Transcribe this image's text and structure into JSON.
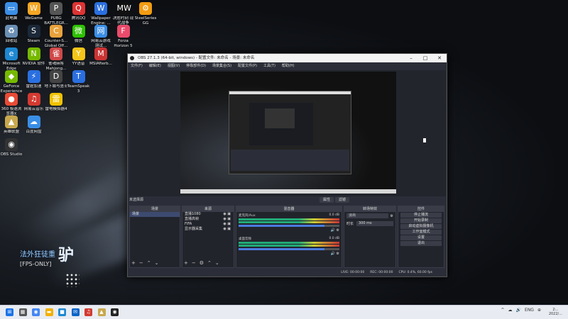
{
  "desktop": {
    "icons": [
      {
        "label": "此电脑",
        "glyph": "▭",
        "color": "#3a8ee6",
        "col": 0,
        "row": 0
      },
      {
        "label": "回收站",
        "glyph": "♻",
        "color": "#6b8fb5",
        "col": 0,
        "row": 1
      },
      {
        "label": "Microsoft Edge",
        "glyph": "e",
        "color": "#1e88d2",
        "col": 0,
        "row": 2
      },
      {
        "label": "GeForce Experience",
        "glyph": "◆",
        "color": "#76b900",
        "col": 0,
        "row": 3
      },
      {
        "label": "360 极速浏览器X",
        "glyph": "●",
        "color": "#e94b35",
        "col": 0,
        "row": 4
      },
      {
        "label": "英雄联盟",
        "glyph": "▲",
        "color": "#c8a84e",
        "col": 0,
        "row": 5
      },
      {
        "label": "OBS Studio",
        "glyph": "◉",
        "color": "#333",
        "col": 0,
        "row": 6
      },
      {
        "label": "WeGame",
        "glyph": "W",
        "color": "#f5a623",
        "col": 1,
        "row": 0
      },
      {
        "label": "Steam",
        "glyph": "S",
        "color": "#1b2838",
        "col": 1,
        "row": 1
      },
      {
        "label": "NVIDIA 软件",
        "glyph": "N",
        "color": "#76b900",
        "col": 1,
        "row": 2
      },
      {
        "label": "雷霆加速",
        "glyph": "⚡",
        "color": "#2a6fe0",
        "col": 1,
        "row": 3
      },
      {
        "label": "网易云音乐",
        "glyph": "♫",
        "color": "#d33a31",
        "col": 1,
        "row": 4
      },
      {
        "label": "百度网盘",
        "glyph": "☁",
        "color": "#3a8ee6",
        "col": 1,
        "row": 5
      },
      {
        "label": "PUBG BATTLEGR...",
        "glyph": "P",
        "color": "#555",
        "col": 2,
        "row": 0
      },
      {
        "label": "Counter-S... Global Off...",
        "glyph": "C",
        "color": "#e8a33d",
        "col": 2,
        "row": 1
      },
      {
        "label": "雀魂麻将 Mahjong...",
        "glyph": "雀",
        "color": "#d04848",
        "col": 2,
        "row": 2
      },
      {
        "label": "地下城与勇士",
        "glyph": "D",
        "color": "#444",
        "col": 2,
        "row": 3
      },
      {
        "label": "雷电模拟器4",
        "glyph": "雷",
        "color": "#f2c200",
        "col": 2,
        "row": 4
      },
      {
        "label": "腾讯QQ",
        "glyph": "Q",
        "color": "#d33",
        "col": 3,
        "row": 0
      },
      {
        "label": "微信",
        "glyph": "微",
        "color": "#2dc100",
        "col": 3,
        "row": 1
      },
      {
        "label": "YY语音",
        "glyph": "Y",
        "color": "#f5c518",
        "col": 3,
        "row": 2
      },
      {
        "label": "TeamSpeak 3",
        "glyph": "T",
        "color": "#2a6fe0",
        "col": 3,
        "row": 3
      },
      {
        "label": "Wallpaper Engine: ...",
        "glyph": "W",
        "color": "#2a6fe0",
        "col": 4,
        "row": 0
      },
      {
        "label": "网易云游戏 测试...",
        "glyph": "网",
        "color": "#3a8ee6",
        "col": 4,
        "row": 1
      },
      {
        "label": "MSIAfterb...",
        "glyph": "M",
        "color": "#c33",
        "col": 4,
        "row": 2
      },
      {
        "label": "决胜时刻 现代战争",
        "glyph": "MW",
        "color": "#111",
        "col": 5,
        "row": 0
      },
      {
        "label": "Forza Horizon 5",
        "glyph": "F",
        "color": "#e94b6b",
        "col": 5,
        "row": 1
      },
      {
        "label": "SteelSeries GG",
        "glyph": "⚙",
        "color": "#f39c12",
        "col": 6,
        "row": 0
      }
    ],
    "watermark": {
      "line1": "法外狂徒重",
      "line2": "[FPS-ONLY]",
      "big": "驴"
    }
  },
  "obs": {
    "title": "OBS 27.1.3 (64-bit, windows) - 配置文件: 未命名 - 场景: 未命名",
    "menu": [
      "文件(F)",
      "编辑(E)",
      "视图(V)",
      "停靠部件(D)",
      "场景集合(S)",
      "配置文件(P)",
      "工具(T)",
      "帮助(H)"
    ],
    "selected_source_label": "未选择源",
    "preview_controls": [
      "属性",
      "滤镜"
    ],
    "docks": {
      "scenes": {
        "title": "场景",
        "items": [
          "场景"
        ]
      },
      "sources": {
        "title": "来源",
        "items": [
          "直播1080",
          "直播高帧",
          "FIFA",
          "显示器采集"
        ]
      },
      "mixer": {
        "title": "混音器",
        "channels": [
          {
            "name": "麦克风/Aux",
            "db": "0.0 dB",
            "level": 0.85
          },
          {
            "name": "桌面音频",
            "db": "0.0 dB",
            "level": 0.85
          }
        ]
      },
      "transitions": {
        "title": "转场特效",
        "type": "淡出",
        "duration_label": "时长",
        "duration": "300 ms"
      },
      "controls": {
        "title": "控件",
        "buttons": [
          "停止播流",
          "开始录制",
          "启动虚拟摄像机",
          "工作室模式",
          "设置",
          "退出"
        ]
      }
    },
    "status": {
      "live": "LIVE: 00:00:00",
      "rec": "REC: 00:00:00",
      "cpu": "CPU: 0.4%, 60.00 fps"
    }
  },
  "taskbar": {
    "apps": [
      {
        "glyph": "⊞",
        "color": "#1a73e8",
        "name": "start"
      },
      {
        "glyph": "▦",
        "color": "#555",
        "name": "task-view"
      },
      {
        "glyph": "◉",
        "color": "#4285f4",
        "name": "chrome"
      },
      {
        "glyph": "▬",
        "color": "#f2b000",
        "name": "explorer"
      },
      {
        "glyph": "■",
        "color": "#1e88d2",
        "name": "store"
      },
      {
        "glyph": "✉",
        "color": "#0a64c8",
        "name": "mail"
      },
      {
        "glyph": "♫",
        "color": "#d33a31",
        "name": "music"
      },
      {
        "glyph": "▲",
        "color": "#c8a84e",
        "name": "game"
      },
      {
        "glyph": "◉",
        "color": "#222",
        "name": "obs"
      }
    ],
    "tray": [
      "^",
      "☁",
      "🔊",
      "ENG",
      "⊕"
    ],
    "time": "2:..",
    "date": "2022/..."
  }
}
